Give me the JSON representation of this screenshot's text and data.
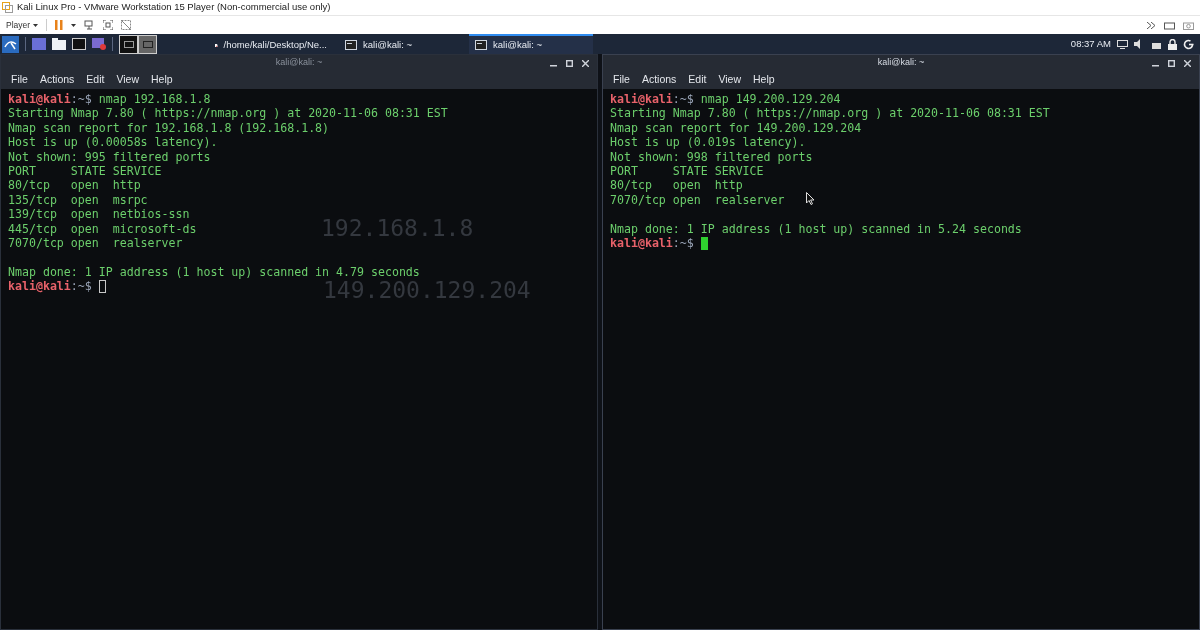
{
  "vm_window": {
    "title": "Kali Linux Pro - VMware Workstation 15 Player (Non-commercial use only)",
    "player_menu": "Player"
  },
  "panel": {
    "tasks": [
      {
        "label": "/home/kali/Desktop/Ne...",
        "kind": "file",
        "selected": false
      },
      {
        "label": "kali@kali: ~",
        "kind": "terminal",
        "selected": false
      },
      {
        "label": "kali@kali: ~",
        "kind": "terminal",
        "selected": true
      }
    ],
    "clock": "08:37 AM"
  },
  "desktop_text": [
    "192.168.1.8",
    "149.200.129.204"
  ],
  "terminals": [
    {
      "title": "kali@kali: ~",
      "focused": false,
      "menu": [
        "File",
        "Actions",
        "Edit",
        "View",
        "Help"
      ],
      "lines": [
        {
          "kind": "prompt",
          "user": "kali@kali",
          "path": ":~$",
          "command": "nmap 192.168.1.8"
        },
        {
          "kind": "output",
          "text": "Starting Nmap 7.80 ( https://nmap.org ) at 2020-11-06 08:31 EST"
        },
        {
          "kind": "output",
          "text": "Nmap scan report for 192.168.1.8 (192.168.1.8)"
        },
        {
          "kind": "output",
          "text": "Host is up (0.00058s latency)."
        },
        {
          "kind": "output",
          "text": "Not shown: 995 filtered ports"
        },
        {
          "kind": "output",
          "text": "PORT     STATE SERVICE"
        },
        {
          "kind": "output",
          "text": "80/tcp   open  http"
        },
        {
          "kind": "output",
          "text": "135/tcp  open  msrpc"
        },
        {
          "kind": "output",
          "text": "139/tcp  open  netbios-ssn"
        },
        {
          "kind": "output",
          "text": "445/tcp  open  microsoft-ds"
        },
        {
          "kind": "output",
          "text": "7070/tcp open  realserver"
        },
        {
          "kind": "blank"
        },
        {
          "kind": "output",
          "text": "Nmap done: 1 IP address (1 host up) scanned in 4.79 seconds"
        },
        {
          "kind": "prompt",
          "user": "kali@kali",
          "path": ":~$",
          "cursor": true
        }
      ]
    },
    {
      "title": "kali@kali: ~",
      "focused": true,
      "menu": [
        "File",
        "Actions",
        "Edit",
        "View",
        "Help"
      ],
      "lines": [
        {
          "kind": "prompt",
          "user": "kali@kali",
          "path": ":~$",
          "command": "nmap 149.200.129.204"
        },
        {
          "kind": "output",
          "text": "Starting Nmap 7.80 ( https://nmap.org ) at 2020-11-06 08:31 EST"
        },
        {
          "kind": "output",
          "text": "Nmap scan report for 149.200.129.204"
        },
        {
          "kind": "output",
          "text": "Host is up (0.019s latency)."
        },
        {
          "kind": "output",
          "text": "Not shown: 998 filtered ports"
        },
        {
          "kind": "output",
          "text": "PORT     STATE SERVICE"
        },
        {
          "kind": "output",
          "text": "80/tcp   open  http"
        },
        {
          "kind": "output",
          "text": "7070/tcp open  realserver"
        },
        {
          "kind": "blank"
        },
        {
          "kind": "output",
          "text": "Nmap done: 1 IP address (1 host up) scanned in 5.24 seconds"
        },
        {
          "kind": "prompt",
          "user": "kali@kali",
          "path": ":~$",
          "cursor": true
        }
      ]
    }
  ]
}
